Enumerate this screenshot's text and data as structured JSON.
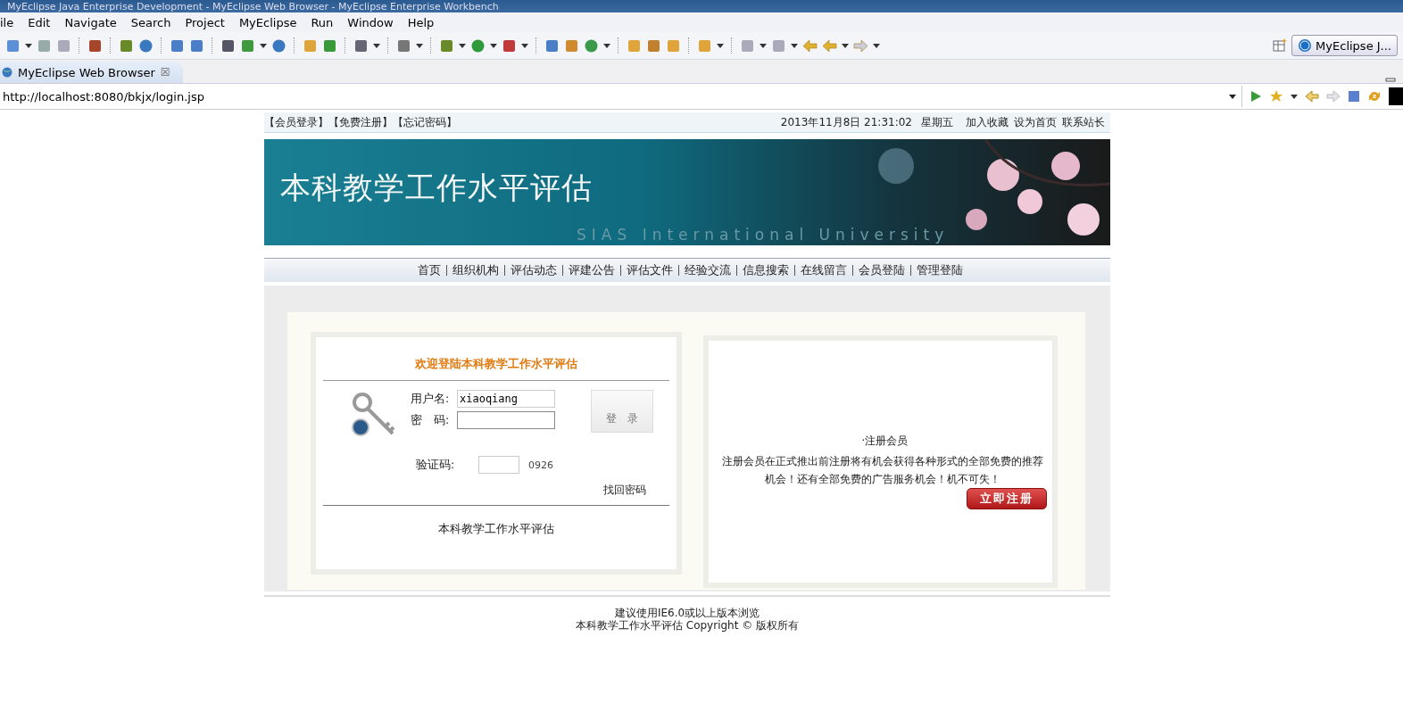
{
  "window": {
    "title": "MyEclipse Java Enterprise Development - MyEclipse Web Browser - MyEclipse Enterprise Workbench"
  },
  "menu": [
    "ile",
    "Edit",
    "Navigate",
    "Search",
    "Project",
    "MyEclipse",
    "Run",
    "Window",
    "Help"
  ],
  "perspective": {
    "label": "MyEclipse J..."
  },
  "editor_tab": {
    "label": "MyEclipse Web Browser",
    "close": "☒"
  },
  "browser": {
    "url": "http://localhost:8080/bkjx/login.jsp"
  },
  "page": {
    "top_links": [
      "【会员登录】",
      "【免费注册】",
      "【忘记密码】"
    ],
    "datetime": "2013年11月8日 21:31:02",
    "weekday": "星期五",
    "site_links": [
      "加入收藏",
      "设为首页",
      "联系站长"
    ],
    "banner": {
      "title": "本科教学工作水平评估",
      "subtitle": "SIAS International University"
    },
    "nav": [
      "首页",
      "组织机构",
      "评估动态",
      "评建公告",
      "评估文件",
      "经验交流",
      "信息搜索",
      "在线留言",
      "会员登陆",
      "管理登陆"
    ],
    "login": {
      "heading": "欢迎登陆本科教学工作水平评估",
      "username_label": "用户名:",
      "username": "xiaoqiang",
      "password_label": "密　码:",
      "login_button": "登　录",
      "captcha_label": "验证码:",
      "captcha_code": "0926",
      "forgot": "找回密码",
      "footer": "本科教学工作水平评估"
    },
    "register": {
      "heading": "·注册会员",
      "text": "注册会员在正式推出前注册将有机会获得各种形式的全部免费的推荐机会！还有全部免费的广告服务机会！机不可失！",
      "button": "立即注册"
    },
    "footer": [
      "建议使用IE6.0或以上版本浏览",
      "本科教学工作水平评估 Copyright © 版权所有"
    ]
  }
}
